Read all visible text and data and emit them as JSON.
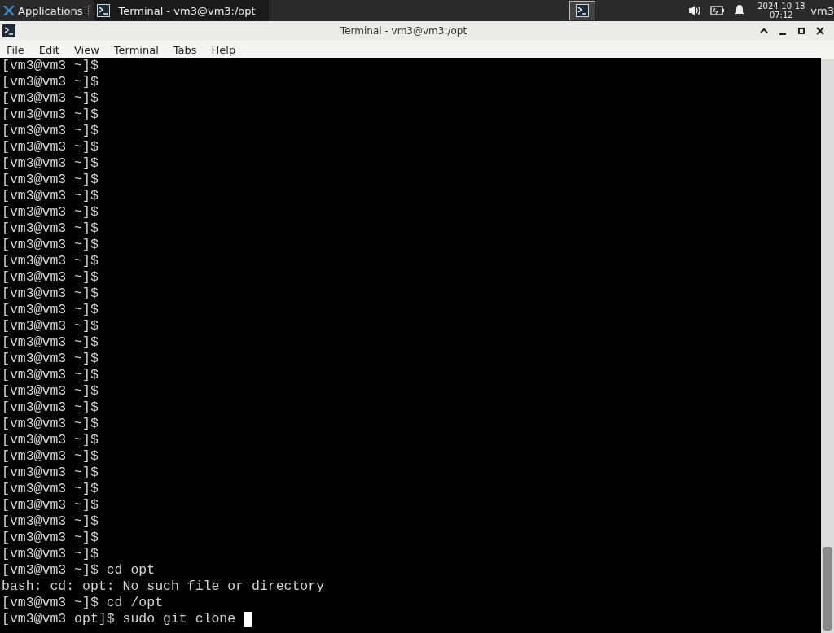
{
  "panel": {
    "apps_label": "Applications",
    "task": {
      "title": "Terminal - vm3@vm3:/opt",
      "selected": true
    },
    "clock": {
      "date": "2024-10-18",
      "time": "07:12"
    },
    "user": "vm3"
  },
  "window": {
    "title": "Terminal - vm3@vm3:/opt"
  },
  "menu": [
    "File",
    "Edit",
    "View",
    "Terminal",
    "Tabs",
    "Help"
  ],
  "terminal": {
    "cursor": true,
    "lines": [
      "[vm3@vm3 ~]$",
      "[vm3@vm3 ~]$",
      "[vm3@vm3 ~]$",
      "[vm3@vm3 ~]$",
      "[vm3@vm3 ~]$",
      "[vm3@vm3 ~]$",
      "[vm3@vm3 ~]$",
      "[vm3@vm3 ~]$",
      "[vm3@vm3 ~]$",
      "[vm3@vm3 ~]$",
      "[vm3@vm3 ~]$",
      "[vm3@vm3 ~]$",
      "[vm3@vm3 ~]$",
      "[vm3@vm3 ~]$",
      "[vm3@vm3 ~]$",
      "[vm3@vm3 ~]$",
      "[vm3@vm3 ~]$",
      "[vm3@vm3 ~]$",
      "[vm3@vm3 ~]$",
      "[vm3@vm3 ~]$",
      "[vm3@vm3 ~]$",
      "[vm3@vm3 ~]$",
      "[vm3@vm3 ~]$",
      "[vm3@vm3 ~]$",
      "[vm3@vm3 ~]$",
      "[vm3@vm3 ~]$",
      "[vm3@vm3 ~]$",
      "[vm3@vm3 ~]$",
      "[vm3@vm3 ~]$",
      "[vm3@vm3 ~]$",
      "[vm3@vm3 ~]$",
      "[vm3@vm3 ~]$ cd opt",
      "bash: cd: opt: No such file or directory",
      "[vm3@vm3 ~]$ cd /opt",
      "[vm3@vm3 opt]$ sudo git clone"
    ]
  }
}
